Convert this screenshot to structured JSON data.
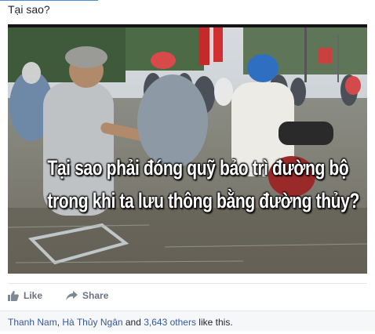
{
  "post": {
    "text": "Tại sao?"
  },
  "photo": {
    "caption_line1": "Tại sao phải đóng quỹ bảo trì đường bộ",
    "caption_line2": "trong khi ta lưu thông bằng đường thủy?"
  },
  "actions": {
    "like_label": "Like",
    "share_label": "Share"
  },
  "likes": {
    "person1": "Thanh Nam",
    "separator": ",",
    "person2": "Hà Thủy Ngân",
    "and": " and ",
    "others": "3,643 others",
    "suffix": " like this."
  },
  "colors": {
    "link": "#365899",
    "action_text": "#6a7180"
  }
}
